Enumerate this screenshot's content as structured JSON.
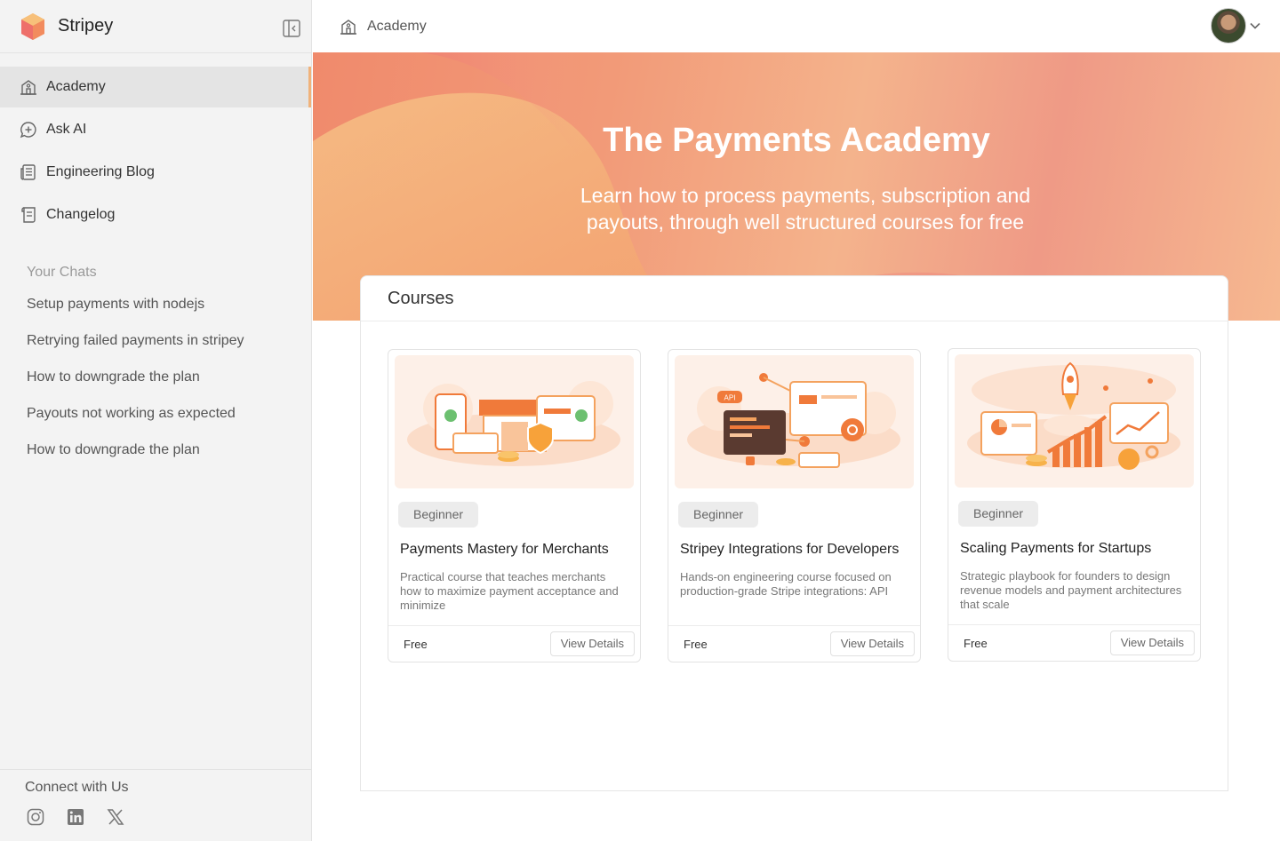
{
  "app": {
    "name": "Stripey"
  },
  "sidebar": {
    "nav": [
      {
        "label": "Academy",
        "icon": "academy-icon",
        "active": true
      },
      {
        "label": "Ask AI",
        "icon": "ask-ai-icon",
        "active": false
      },
      {
        "label": "Engineering Blog",
        "icon": "blog-icon",
        "active": false
      },
      {
        "label": "Changelog",
        "icon": "changelog-icon",
        "active": false
      }
    ],
    "chats_title": "Your Chats",
    "chats": [
      "Setup payments with nodejs",
      "Retrying failed payments in stripey",
      "How to downgrade the plan",
      "Payouts not working as expected",
      "How to downgrade the plan"
    ],
    "connect_title": "Connect with Us",
    "socials": [
      "instagram-icon",
      "linkedin-icon",
      "x-icon"
    ]
  },
  "header": {
    "title": "Academy"
  },
  "hero": {
    "title": "The Payments Academy",
    "subtitle": "Learn how to process payments, subscription and payouts, through well structured courses for free"
  },
  "courses": {
    "title": "Courses",
    "items": [
      {
        "level": "Beginner",
        "title": "Payments Mastery for Merchants",
        "description": "Practical course that teaches merchants how to maximize payment acceptance and minimize",
        "price": "Free",
        "action": "View Details"
      },
      {
        "level": "Beginner",
        "title": "Stripey Integrations for Developers",
        "description": "Hands-on engineering course focused on production-grade Stripe integrations: API",
        "price": "Free",
        "action": "View Details"
      },
      {
        "level": "Beginner",
        "title": "Scaling Payments for Startups",
        "description": "Strategic playbook for founders to design revenue models and payment architectures that scale",
        "price": "Free",
        "action": "View Details"
      }
    ],
    "illustrations": [
      "storefront-illustration",
      "api-integration-illustration",
      "growth-rocket-illustration"
    ],
    "illustration_labels": {
      "api": "API"
    }
  },
  "colors": {
    "accent": "#f0b27a",
    "hero_start": "#f08a6c",
    "hero_end": "#f6b890",
    "illustration_orange": "#f07a3a"
  }
}
